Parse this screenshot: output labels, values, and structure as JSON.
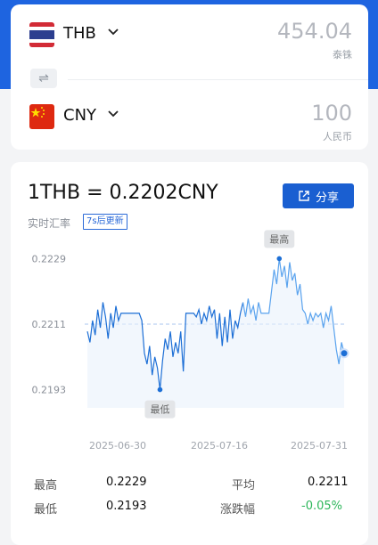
{
  "converter": {
    "from": {
      "code": "THB",
      "amount": "454.04",
      "name": "泰铢"
    },
    "to": {
      "code": "CNY",
      "amount": "100",
      "name": "人民币"
    },
    "swap_icon": "swap-icon"
  },
  "header": {
    "rate_text": "1THB = 0.2202CNY",
    "subtitle": "实时汇率",
    "refresh_badge": "7s后更新",
    "share_label": "分享"
  },
  "chart_data": {
    "type": "line",
    "title": "",
    "x_labels": [
      "2025-06-30",
      "2025-07-16",
      "2025-07-31"
    ],
    "y_ticks": [
      0.2229,
      0.2211,
      0.2193
    ],
    "ylim": [
      0.2188,
      0.2234
    ],
    "reference_line": 0.2211,
    "max_marker": {
      "label": "最高",
      "value": 0.2229
    },
    "min_marker": {
      "label": "最低",
      "value": 0.2193
    },
    "series": [
      {
        "values": [
          0.2209,
          0.2206,
          0.2212,
          0.2208,
          0.2215,
          0.221,
          0.2217,
          0.2213,
          0.2207,
          0.2214,
          0.221,
          0.2216,
          0.2212,
          0.2214,
          0.2214,
          0.2214,
          0.2214,
          0.2214,
          0.2214,
          0.2214,
          0.2214,
          0.2212,
          0.2203,
          0.22,
          0.2205,
          0.2197,
          0.2202,
          0.2199,
          0.2193,
          0.2201,
          0.2207,
          0.2204,
          0.2209,
          0.2202,
          0.2206,
          0.2203,
          0.2209,
          0.2198,
          0.2214,
          0.2214,
          0.2214,
          0.2214,
          0.2213,
          0.2215,
          0.2211,
          0.2214,
          0.2212,
          0.2216,
          0.2213,
          0.2215,
          0.2207,
          0.2214,
          0.2205,
          0.2213,
          0.2206,
          0.2215,
          0.2207,
          0.2212,
          0.221,
          0.2214,
          0.2217,
          0.2213,
          0.2218,
          0.2214,
          0.2216,
          0.2212,
          0.2217,
          0.2214,
          0.2214,
          0.2214,
          0.2214,
          0.222,
          0.2226,
          0.2222,
          0.2229,
          0.2224,
          0.2227,
          0.2221,
          0.2228,
          0.2223,
          0.2225,
          0.2219,
          0.2222,
          0.2215,
          0.2214,
          0.2211,
          0.2214,
          0.2212,
          0.2214,
          0.2213,
          0.2214,
          0.221,
          0.2214,
          0.2212,
          0.2216,
          0.221,
          0.2204,
          0.22,
          0.2206,
          0.2203
        ]
      }
    ]
  },
  "stats": {
    "high_label": "最高",
    "high_value": "0.2229",
    "avg_label": "平均",
    "avg_value": "0.2211",
    "low_label": "最低",
    "low_value": "0.2193",
    "change_label": "涨跌幅",
    "change_value": "-0.05%"
  },
  "colors": {
    "brand": "#1e64e0",
    "line": "#1d6fd6",
    "negative": "#2cb65a"
  }
}
